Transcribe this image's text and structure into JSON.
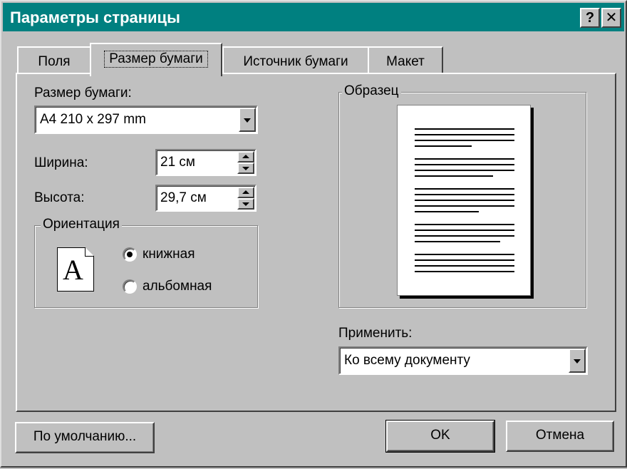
{
  "dialog": {
    "title": "Параметры страницы",
    "help_button": "?",
    "close_button": "✕"
  },
  "tabs": [
    {
      "label": "Поля",
      "active": false
    },
    {
      "label": "Размер бумаги",
      "active": true
    },
    {
      "label": "Источник бумаги",
      "active": false
    },
    {
      "label": "Макет",
      "active": false
    }
  ],
  "paper_size": {
    "label": "Размер бумаги:",
    "value": "A4 210 x 297 mm"
  },
  "width": {
    "label": "Ширина:",
    "value": "21 см"
  },
  "height": {
    "label": "Высота:",
    "value": "29,7 см"
  },
  "orientation": {
    "title": "Ориентация",
    "icon_letter": "A",
    "options": [
      {
        "label": "книжная",
        "selected": true
      },
      {
        "label": "альбомная",
        "selected": false
      }
    ]
  },
  "sample": {
    "title": "Образец"
  },
  "apply": {
    "label": "Применить:",
    "value": "Ко всему документу"
  },
  "buttons": {
    "default_label": "По умолчанию...",
    "ok_label": "OK",
    "cancel_label": "Отмена"
  }
}
